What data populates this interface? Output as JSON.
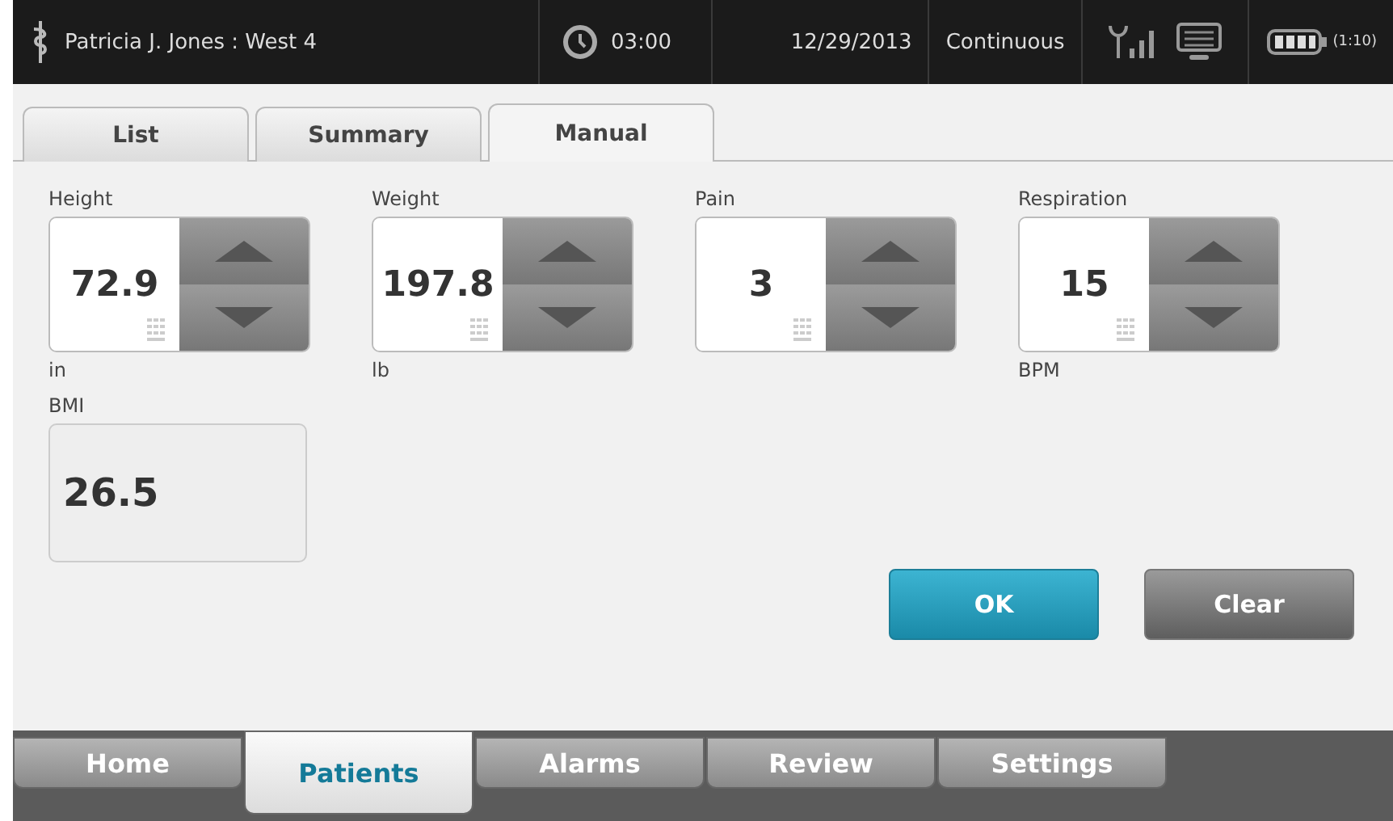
{
  "status_bar": {
    "patient": "Patricia J. Jones : West 4",
    "time": "03:00",
    "date": "12/29/2013",
    "mode": "Continuous",
    "battery_time": "(1:10)"
  },
  "tabs": [
    {
      "label": "List",
      "selected": false
    },
    {
      "label": "Summary",
      "selected": false
    },
    {
      "label": "Manual",
      "selected": true
    }
  ],
  "vitals": [
    {
      "label": "Height",
      "value": "72.9",
      "unit": "in"
    },
    {
      "label": "Weight",
      "value": "197.8",
      "unit": "lb"
    },
    {
      "label": "Pain",
      "value": "3"
    },
    {
      "label": "Respiration",
      "value": "15",
      "unit": "BPM"
    }
  ],
  "bmi": {
    "label": "BMI",
    "value": "26.5"
  },
  "buttons": [
    {
      "label": "OK",
      "kind": "primary"
    },
    {
      "label": "Clear",
      "kind": "secondary"
    }
  ],
  "nav": [
    {
      "label": "Home",
      "selected": false
    },
    {
      "label": "Patients",
      "selected": true
    },
    {
      "label": "Alarms",
      "selected": false
    },
    {
      "label": "Review",
      "selected": false
    },
    {
      "label": "Settings",
      "selected": false
    }
  ]
}
